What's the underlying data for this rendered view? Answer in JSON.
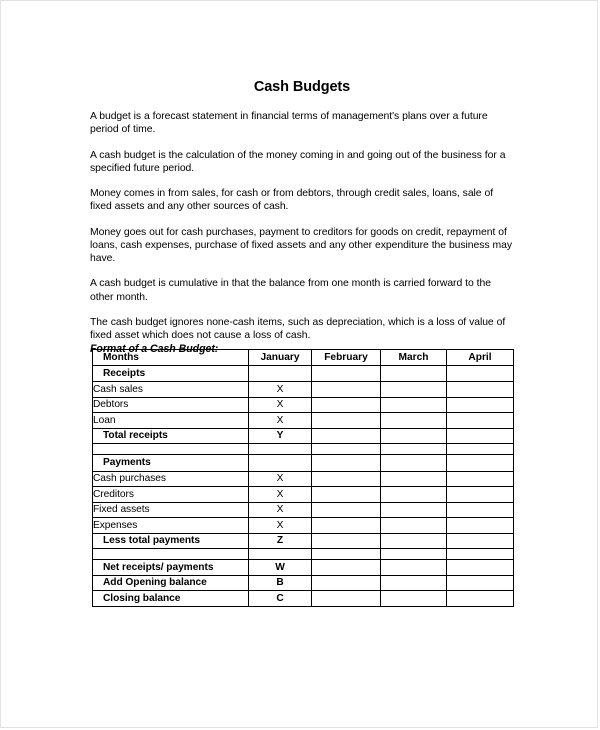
{
  "document": {
    "title": "Cash Budgets",
    "paragraphs": [
      "A budget is a forecast statement in financial terms of management's plans over a future period of time.",
      "A cash budget is the calculation of the money coming in and going out of the business for a specified future period.",
      "Money comes in from sales, for cash or from debtors, through credit sales, loans, sale of fixed assets and any other sources of cash.",
      "Money goes out for cash purchases, payment to creditors for goods on credit, repayment of loans, cash expenses, purchase of fixed assets and any other expenditure the business may have.",
      "A cash budget is cumulative in that the balance from one month is carried forward to the other month.",
      "The cash budget ignores none-cash items, such as depreciation, which is a loss of value of fixed asset which does not cause a loss of cash."
    ],
    "subheading": "Format of a Cash Budget:"
  },
  "table": {
    "columns": [
      "Months",
      "January",
      "February",
      "March",
      "April"
    ],
    "rows": [
      {
        "type": "header",
        "label": "Months",
        "bold_label": true,
        "values": [
          "January",
          "February",
          "March",
          "April"
        ],
        "bold_values": true
      },
      {
        "type": "section",
        "label": "Receipts",
        "bold_label": true,
        "values": [
          "",
          "",
          "",
          ""
        ],
        "bold_values": false
      },
      {
        "type": "data",
        "label": "Cash sales",
        "bold_label": false,
        "values": [
          "X",
          "",
          "",
          ""
        ],
        "bold_values": false
      },
      {
        "type": "data",
        "label": "Debtors",
        "bold_label": false,
        "values": [
          "X",
          "",
          "",
          ""
        ],
        "bold_values": false
      },
      {
        "type": "data",
        "label": "Loan",
        "bold_label": false,
        "values": [
          "X",
          "",
          "",
          ""
        ],
        "bold_values": false
      },
      {
        "type": "total",
        "label": "Total receipts",
        "bold_label": true,
        "values": [
          "Y",
          "",
          "",
          ""
        ],
        "bold_values": true
      },
      {
        "type": "spacer",
        "label": "",
        "bold_label": false,
        "values": [
          "",
          "",
          "",
          ""
        ],
        "bold_values": false
      },
      {
        "type": "section",
        "label": "Payments",
        "bold_label": true,
        "values": [
          "",
          "",
          "",
          ""
        ],
        "bold_values": false
      },
      {
        "type": "data",
        "label": "Cash purchases",
        "bold_label": false,
        "values": [
          "X",
          "",
          "",
          ""
        ],
        "bold_values": false
      },
      {
        "type": "data",
        "label": "Creditors",
        "bold_label": false,
        "values": [
          "X",
          "",
          "",
          ""
        ],
        "bold_values": false
      },
      {
        "type": "data",
        "label": "Fixed assets",
        "bold_label": false,
        "values": [
          "X",
          "",
          "",
          ""
        ],
        "bold_values": false
      },
      {
        "type": "data",
        "label": "Expenses",
        "bold_label": false,
        "values": [
          "X",
          "",
          "",
          ""
        ],
        "bold_values": false
      },
      {
        "type": "total",
        "label": "Less total payments",
        "bold_label": true,
        "values": [
          "Z",
          "",
          "",
          ""
        ],
        "bold_values": true
      },
      {
        "type": "spacer",
        "label": "",
        "bold_label": false,
        "values": [
          "",
          "",
          "",
          ""
        ],
        "bold_values": false
      },
      {
        "type": "total",
        "label": "Net receipts/ payments",
        "bold_label": true,
        "values": [
          "W",
          "",
          "",
          ""
        ],
        "bold_values": true
      },
      {
        "type": "total",
        "label": "Add Opening balance",
        "bold_label": true,
        "values": [
          "B",
          "",
          "",
          ""
        ],
        "bold_values": true
      },
      {
        "type": "total",
        "label": "Closing balance",
        "bold_label": true,
        "values": [
          "C",
          "",
          "",
          ""
        ],
        "bold_values": true
      }
    ]
  }
}
